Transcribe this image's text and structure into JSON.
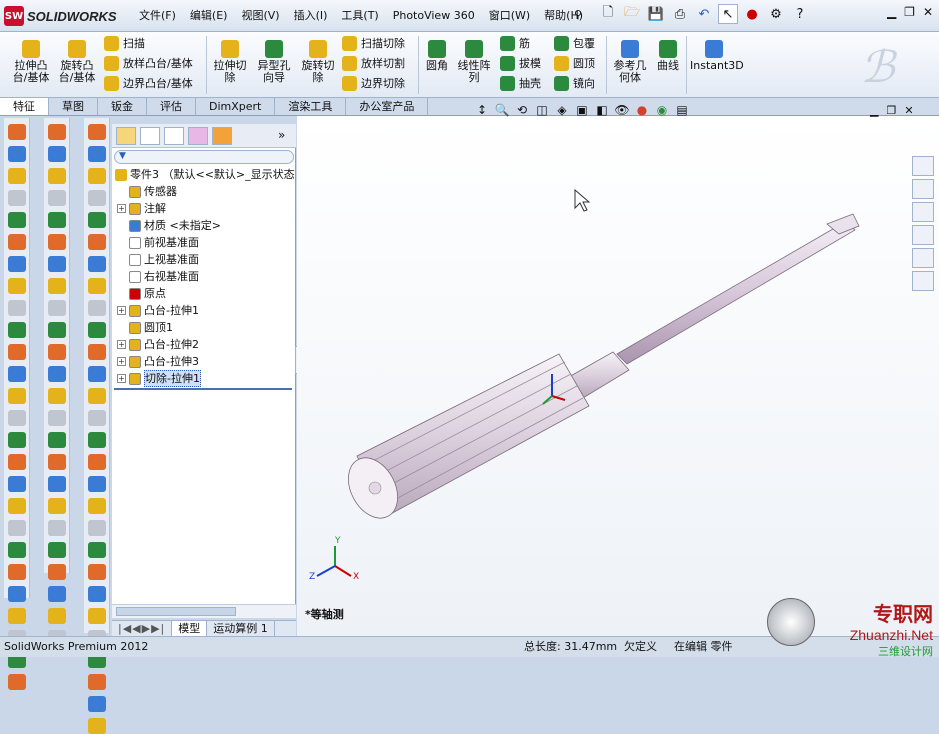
{
  "app": {
    "brand_badge": "SW",
    "brand": "SOLIDWORKS",
    "product": "SolidWorks Premium 2012"
  },
  "menu": [
    "文件(F)",
    "编辑(E)",
    "视图(V)",
    "插入(I)",
    "工具(T)",
    "PhotoView 360",
    "窗口(W)",
    "帮助(H)"
  ],
  "ribbon": {
    "big": [
      {
        "label": "拉伸凸台/基体",
        "icon": "extrude-boss-icon",
        "color": "#e4b21b"
      },
      {
        "label": "旋转凸台/基体",
        "icon": "revolve-boss-icon",
        "color": "#e4b21b"
      },
      {
        "label": "拉伸切除",
        "icon": "extrude-cut-icon",
        "color": "#e4b21b"
      },
      {
        "label": "异型孔向导",
        "icon": "hole-wizard-icon",
        "color": "#2c8a3e"
      },
      {
        "label": "旋转切除",
        "icon": "revolve-cut-icon",
        "color": "#e4b21b"
      },
      {
        "label": "圆角",
        "icon": "fillet-icon",
        "color": "#2c8a3e"
      },
      {
        "label": "线性阵列",
        "icon": "linear-pattern-icon",
        "color": "#2c8a3e"
      },
      {
        "label": "参考几何体",
        "icon": "reference-geometry-icon",
        "color": "#3a7bd5"
      },
      {
        "label": "曲线",
        "icon": "curves-icon",
        "color": "#2c8a3e"
      },
      {
        "label": "Instant3D",
        "icon": "instant3d-icon",
        "color": "#3a7bd5"
      }
    ],
    "small1": [
      "扫描",
      "放样凸台/基体",
      "边界凸台/基体"
    ],
    "small2": [
      "扫描切除",
      "放样切割",
      "边界切除"
    ],
    "small3": [
      "筋",
      "拔模",
      "抽壳"
    ],
    "small4": [
      "包覆",
      "圆顶",
      "镜向"
    ]
  },
  "tabs": [
    "特征",
    "草图",
    "钣金",
    "评估",
    "DimXpert",
    "渲染工具",
    "办公室产品"
  ],
  "tree": {
    "root": "零件3 （默认<<默认>_显示状态",
    "items": [
      "传感器",
      "注解",
      "材质 <未指定>",
      "前视基准面",
      "上视基准面",
      "右视基准面",
      "原点",
      "凸台-拉伸1",
      "圆顶1",
      "凸台-拉伸2",
      "凸台-拉伸3",
      "切除-拉伸1"
    ]
  },
  "bottom_tabs": [
    "模型",
    "运动算例 1"
  ],
  "view": {
    "label": "*等轴测",
    "axis_x": "X",
    "axis_y": "Y",
    "axis_z": "Z"
  },
  "status": {
    "length": "总长度: 31.47mm",
    "defined": "欠定义",
    "editing": "在编辑 零件"
  },
  "watermark": {
    "cn": "专职网",
    "url": "Zhuanzhi.Net",
    "sub": "三维设计网"
  }
}
